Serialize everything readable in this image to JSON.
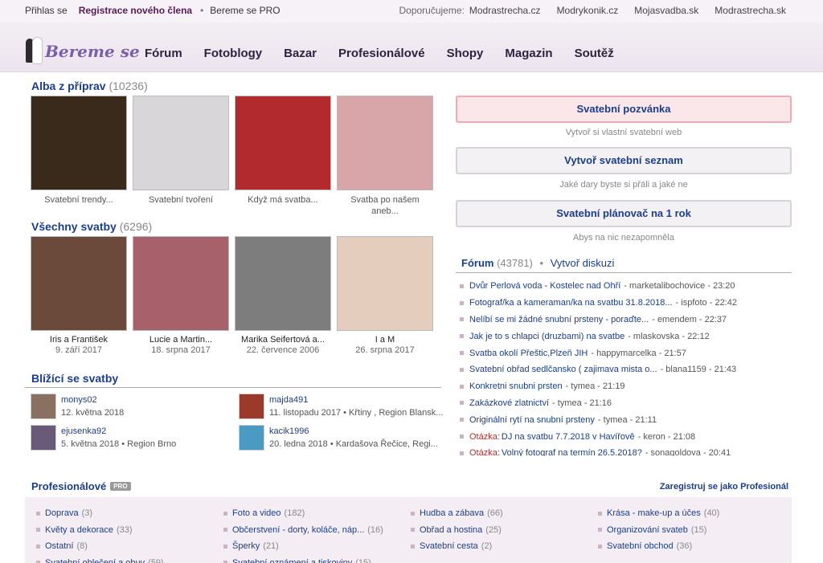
{
  "topbar": {
    "login": "Přihlas se",
    "register": "Registrace nového člena",
    "separator": "•",
    "pro": "Bereme se PRO",
    "recommend_label": "Doporučujeme:",
    "recommend": [
      "Modrastrecha.cz",
      "Modrykonik.cz",
      "Mojasvadba.sk",
      "Modrastrecha.sk"
    ]
  },
  "logo": {
    "text": "Bereme se"
  },
  "nav": [
    "Fórum",
    "Fotoblogy",
    "Bazar",
    "Profesionálové",
    "Shopy",
    "Magazin",
    "Soutěž"
  ],
  "albums": {
    "title": "Alba z příprav",
    "count": "(10236)",
    "items": [
      {
        "caption": "Svatební trendy...",
        "color": "#3a2a1c"
      },
      {
        "caption": "Svatební tvoření",
        "color": "#d9d6da"
      },
      {
        "caption": "Když má svatba...",
        "color": "#b32a2e"
      },
      {
        "caption": "Svatba po našem aneb...",
        "color": "#d8a5a8"
      }
    ]
  },
  "weddings": {
    "title": "Všechny svatby",
    "count": "(6296)",
    "items": [
      {
        "name": "Iris a František",
        "date": "9. září 2017",
        "color": "#6b4a3c"
      },
      {
        "name": "Lucie a Martin...",
        "date": "18. srpna 2017",
        "color": "#a6616a"
      },
      {
        "name": "Marika Seifertová a...",
        "date": "22. července 2006",
        "color": "#7d7d7d"
      },
      {
        "name": "I a M",
        "date": "26. srpna 2017",
        "color": "#e4cdbc"
      }
    ]
  },
  "upcoming": {
    "title": "Blížící se svatby",
    "items": [
      {
        "name": "monys02",
        "detail": "12. května 2018",
        "color": "#8a7060"
      },
      {
        "name": "majda491",
        "detail": "11. listopadu 2017 • Křtiny , Region Blansk...",
        "color": "#9b3a2a"
      },
      {
        "name": "ejusenka92",
        "detail": "5. května 2018 • Region Brno",
        "color": "#6a5a7a"
      },
      {
        "name": "kacik1996",
        "detail": "20. ledna 2018 • Kardašova Řečice, Regi...",
        "color": "#4a9ac4"
      }
    ]
  },
  "cta": [
    {
      "label": "Svatební pozvánka",
      "sub": "Vytvoř si vlastní svatební web"
    },
    {
      "label": "Vytvoř svatební seznam",
      "sub": "Jaké dary byste si přáli a jaké ne"
    },
    {
      "label": "Svatební plánovač na 1 rok",
      "sub": "Abys na nic nezapomněla"
    }
  ],
  "forum": {
    "title": "Fórum",
    "count": "(43781)",
    "separator": "•",
    "create": "Vytvoř diskuzi",
    "items": [
      {
        "prefix": "",
        "title": "Dvůr Perlová voda - Kostelec nad Ohří",
        "meta": "- marketalibochovice - 23:20"
      },
      {
        "prefix": "",
        "title": "Fotograf/ka a kameraman/ka na svatbu 31.8.2018...",
        "meta": "- ispfoto - 22:42"
      },
      {
        "prefix": "",
        "title": "Nelíbí se mi žádné snubní prsteny - poraďte...",
        "meta": "- emendem - 22:37"
      },
      {
        "prefix": "",
        "title": "Jak je to s chlapci (druzbami) na svatbe",
        "meta": "- mlaskovska - 22:12"
      },
      {
        "prefix": "",
        "title": "Svatba okolí Přeštic,Plzeň JIH",
        "meta": "- happymarcelka - 21:57"
      },
      {
        "prefix": "",
        "title": "Svatební obřad sedlčansko ( zajimava mista o...",
        "meta": "- blana1159 - 21:43"
      },
      {
        "prefix": "",
        "title": "Konkretni snubni prsten",
        "meta": "- tymea - 21:19"
      },
      {
        "prefix": "",
        "title": "Zakázkové zlatnictví",
        "meta": "- tymea - 21:16"
      },
      {
        "prefix": "",
        "title": "Originální rytí na snubní prsteny",
        "meta": "- tymea - 21:11"
      },
      {
        "prefix": "Otázka:",
        "title": "DJ na svatbu 7.7.2018 v Havířově",
        "meta": "- keron - 21:08"
      },
      {
        "prefix": "Otázka:",
        "title": "Volný fotograf na termín 26.5.2018?",
        "meta": "- sonagoldova - 20:41"
      }
    ]
  },
  "professionals": {
    "title": "Profesionálové",
    "badge": "PRO",
    "register": "Zaregistruj se jako Profesionál",
    "columns": [
      [
        {
          "label": "Doprava",
          "count": "(3)"
        },
        {
          "label": "Květy a dekorace",
          "count": "(33)"
        },
        {
          "label": "Ostatní",
          "count": "(8)"
        },
        {
          "label": "Svatební oblečení a obuv",
          "count": "(59)"
        }
      ],
      [
        {
          "label": "Foto a video",
          "count": "(182)"
        },
        {
          "label": "Občerstvení - dorty, koláče, náp...",
          "count": "(16)"
        },
        {
          "label": "Šperky",
          "count": "(21)"
        },
        {
          "label": "Svatební oznámení a tiskoviny",
          "count": "(15)"
        }
      ],
      [
        {
          "label": "Hudba a zábava",
          "count": "(66)"
        },
        {
          "label": "Obřad a hostina",
          "count": "(25)"
        },
        {
          "label": "Svatební cesta",
          "count": "(2)"
        }
      ],
      [
        {
          "label": "Krása - make-up a účes",
          "count": "(40)"
        },
        {
          "label": "Organizování svateb",
          "count": "(15)"
        },
        {
          "label": "Svatební obchod",
          "count": "(36)"
        }
      ]
    ]
  }
}
